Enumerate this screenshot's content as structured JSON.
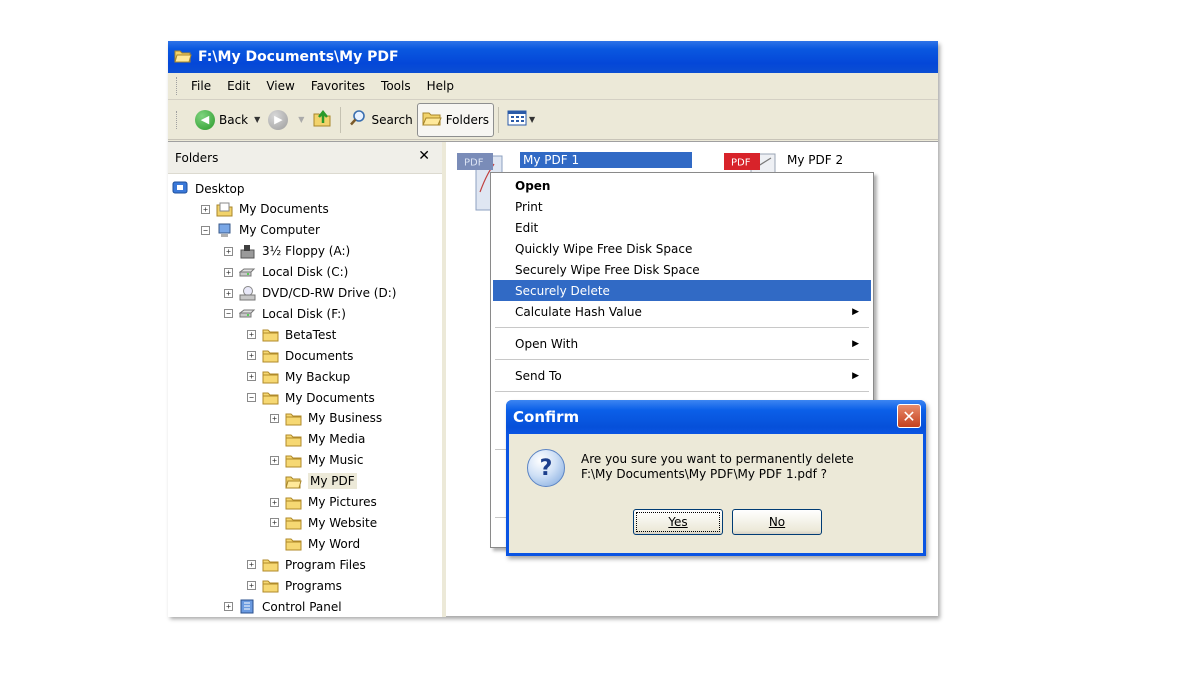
{
  "window": {
    "title": "F:\\My Documents\\My PDF"
  },
  "menubar": {
    "items": [
      "File",
      "Edit",
      "View",
      "Favorites",
      "Tools",
      "Help"
    ]
  },
  "toolbar": {
    "back_label": "Back",
    "search_label": "Search",
    "folders_label": "Folders"
  },
  "folders_pane": {
    "title": "Folders",
    "tree": [
      {
        "label": "Desktop",
        "icon": "desktop-icon",
        "depth": 0,
        "expander": "none"
      },
      {
        "label": "My Documents",
        "icon": "documents-folder-icon",
        "depth": 1,
        "expander": "plus"
      },
      {
        "label": "My Computer",
        "icon": "computer-icon",
        "depth": 1,
        "expander": "minus"
      },
      {
        "label": "3½ Floppy (A:)",
        "icon": "floppy-icon",
        "depth": 2,
        "expander": "plus"
      },
      {
        "label": "Local Disk (C:)",
        "icon": "disk-icon",
        "depth": 2,
        "expander": "plus"
      },
      {
        "label": "DVD/CD-RW Drive (D:)",
        "icon": "cd-drive-icon",
        "depth": 2,
        "expander": "plus"
      },
      {
        "label": "Local Disk (F:)",
        "icon": "disk-icon",
        "depth": 2,
        "expander": "minus"
      },
      {
        "label": "BetaTest",
        "icon": "folder-icon",
        "depth": 3,
        "expander": "plus"
      },
      {
        "label": "Documents",
        "icon": "folder-icon",
        "depth": 3,
        "expander": "plus"
      },
      {
        "label": "My Backup",
        "icon": "folder-icon",
        "depth": 3,
        "expander": "plus"
      },
      {
        "label": "My Documents",
        "icon": "folder-icon",
        "depth": 3,
        "expander": "minus"
      },
      {
        "label": "My Business",
        "icon": "folder-icon",
        "depth": 4,
        "expander": "plus"
      },
      {
        "label": "My Media",
        "icon": "folder-icon",
        "depth": 4,
        "expander": "none"
      },
      {
        "label": "My Music",
        "icon": "folder-icon",
        "depth": 4,
        "expander": "plus"
      },
      {
        "label": "My PDF",
        "icon": "open-folder-icon",
        "depth": 4,
        "expander": "none",
        "selected": true
      },
      {
        "label": "My Pictures",
        "icon": "folder-icon",
        "depth": 4,
        "expander": "plus"
      },
      {
        "label": "My Website",
        "icon": "folder-icon",
        "depth": 4,
        "expander": "plus"
      },
      {
        "label": "My Word",
        "icon": "folder-icon",
        "depth": 4,
        "expander": "none"
      },
      {
        "label": "Program Files",
        "icon": "folder-icon",
        "depth": 3,
        "expander": "plus"
      },
      {
        "label": "Programs",
        "icon": "folder-icon",
        "depth": 3,
        "expander": "plus"
      },
      {
        "label": "Control Panel",
        "icon": "control-panel-icon",
        "depth": 2,
        "expander": "plus"
      }
    ]
  },
  "files": [
    {
      "label": "My PDF 1",
      "icon_text": "PDF",
      "selected": true
    },
    {
      "label": "My PDF 2",
      "icon_text": "PDF",
      "selected": false
    }
  ],
  "context_menu": {
    "items": [
      {
        "label": "Open",
        "bold": true
      },
      {
        "label": "Print"
      },
      {
        "label": "Edit"
      },
      {
        "label": "Quickly Wipe Free Disk Space"
      },
      {
        "label": "Securely Wipe Free Disk Space"
      },
      {
        "label": "Securely Delete",
        "highlight": true
      },
      {
        "label": "Calculate Hash Value",
        "submenu": true
      },
      {
        "label": "Open With",
        "submenu": true
      },
      {
        "label": "Send To",
        "submenu": true
      }
    ]
  },
  "dialog": {
    "title": "Confirm",
    "message_line1": "Are you sure you want to permanently delete",
    "message_line2": "F:\\My Documents\\My PDF\\My PDF 1.pdf ?",
    "yes_label": "Yes",
    "no_label": "No"
  },
  "colors": {
    "titlebar": "#0a54e3",
    "selection": "#316ac5",
    "chrome": "#ece9d8",
    "pdf_red": "#d8232a"
  }
}
